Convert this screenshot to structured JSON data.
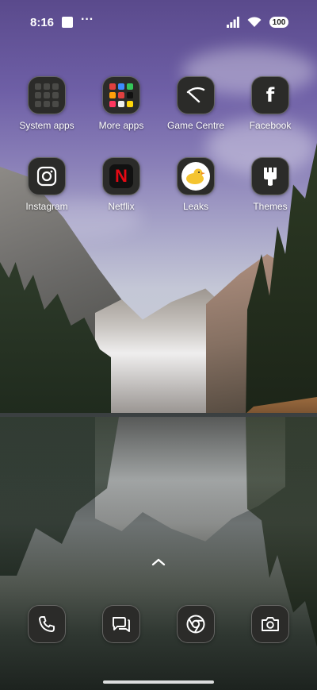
{
  "status_bar": {
    "time": "8:16",
    "more": "···",
    "battery": "100"
  },
  "apps_row1": [
    {
      "label": "System apps",
      "icon": "folder-icon"
    },
    {
      "label": "More apps",
      "icon": "folder-icon"
    },
    {
      "label": "Game Centre",
      "icon": "game-centre-icon"
    },
    {
      "label": "Facebook",
      "icon": "facebook-icon"
    }
  ],
  "apps_row2": [
    {
      "label": "Instagram",
      "icon": "instagram-icon"
    },
    {
      "label": "Netflix",
      "icon": "netflix-icon"
    },
    {
      "label": "Leaks",
      "icon": "leaks-icon"
    },
    {
      "label": "Themes",
      "icon": "themes-brush-icon"
    }
  ],
  "dock": [
    {
      "icon": "phone-icon"
    },
    {
      "icon": "messages-icon"
    },
    {
      "icon": "chrome-icon"
    },
    {
      "icon": "camera-icon"
    }
  ],
  "facebook_glyph": "f",
  "netflix_glyph": "N",
  "colors": {
    "icon_bg": "#2b2b29",
    "netflix_red": "#e50914",
    "leaks_yellow": "#f4c430",
    "more_apps_dots": [
      "#e04040",
      "#3d8bff",
      "#34c759",
      "#ff9f0a",
      "#e04040",
      "#ffffff",
      "#ff375f",
      "#eeeeee",
      "#ffd60a"
    ]
  }
}
